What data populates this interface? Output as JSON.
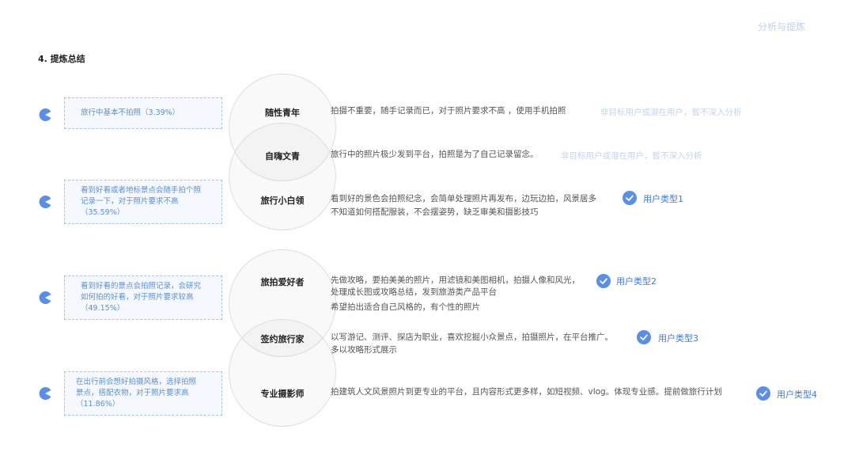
{
  "header": {
    "section_tag": "分析与提炼",
    "title": "4. 提炼总结"
  },
  "callouts": [
    {
      "lines": [
        "旅行中基本不拍照（3.39%）"
      ]
    },
    {
      "lines": [
        "看到好看或者地标景点会随手拍个照",
        "记录一下，对于照片要求不高",
        "（35.59%）"
      ]
    },
    {
      "lines": [
        "看到好看的景点会拍照记录，会研究",
        "如何拍的好看，对于照片要求较高",
        "（49.15%）"
      ]
    },
    {
      "lines": [
        "在出行前会想好拍摄风格，选择拍照",
        "景点，搭配衣物，对于照片要求高",
        "（11.86%）"
      ]
    }
  ],
  "categories": [
    {
      "name": "随性青年",
      "desc": [
        "拍摄不重要，随手记录而已，对于照片要求不高 ，使用手机拍照"
      ],
      "note": "非目标用户或潜在用户，暂不深入分析"
    },
    {
      "name": "自嗨文青",
      "desc": [
        "旅行中的照片极少发到平台，拍照是为了自己记录留念。"
      ],
      "note": "非目标用户或潜在用户，暂不深入分析"
    },
    {
      "name": "旅行小白领",
      "desc": [
        "看到好的景色会拍照纪念，会简单处理照片再发布，边玩边拍，风景居多",
        "不知道如何搭配服装，不会摆姿势，缺乏审美和摄影技巧"
      ],
      "user_type": "用户类型1"
    },
    {
      "name": "旅拍爱好者",
      "desc": [
        "先做攻略，要拍美美的照片，用滤镜和美图相机，拍摄人像和风光，",
        "处理成长图或攻略总结，发到旅游类产品平台",
        "希望拍出适合自己风格的，有个性的照片"
      ],
      "user_type": "用户类型2"
    },
    {
      "name": "签约旅行家",
      "desc": [
        "以写游记、测评、探店为职业，喜欢挖掘小众景点，拍摄照片，在平台推广。",
        "多以攻略形式展示"
      ],
      "user_type": "用户类型3"
    },
    {
      "name": "专业摄影师",
      "desc": [
        "拍建筑人文风景照片到更专业的平台，且内容形式更多样，如短视频、vlog。体现专业感。提前做旅行计划"
      ],
      "user_type": "用户类型4"
    }
  ],
  "colors": {
    "accent": "#5b8fe6",
    "callout_text": "#5b8fd6",
    "muted_note": "#c2d4ee"
  }
}
